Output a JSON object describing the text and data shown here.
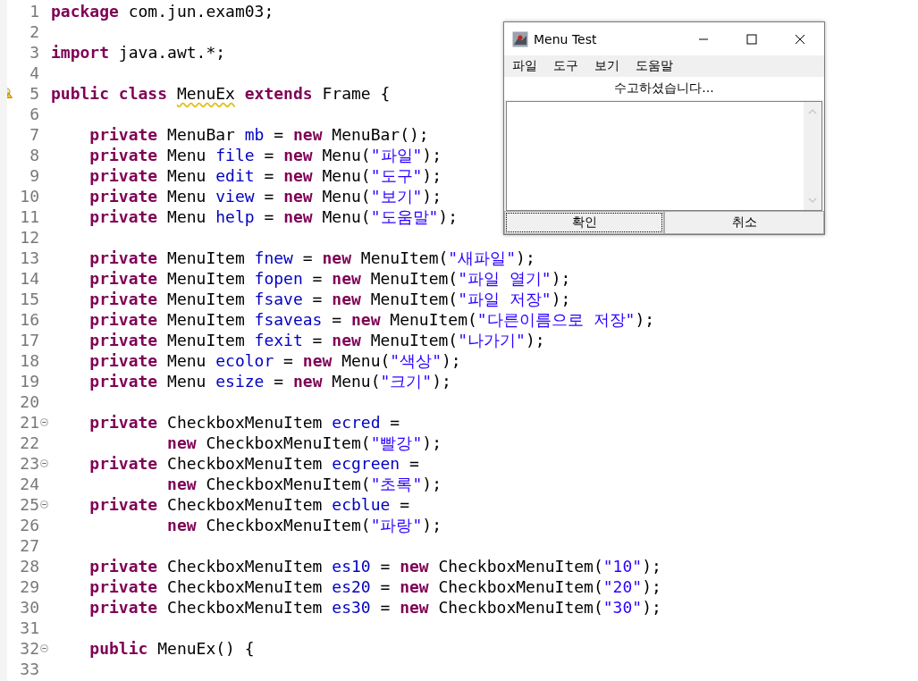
{
  "editor": {
    "lines": [
      {
        "number": "1",
        "tokens": [
          {
            "kind": "kw",
            "text": "package"
          },
          {
            "kind": "plain",
            "text": " com.jun.exam03;"
          }
        ]
      },
      {
        "number": "2"
      },
      {
        "number": "3",
        "tokens": [
          {
            "kind": "kw",
            "text": "import"
          },
          {
            "kind": "plain",
            "text": " java.awt.*;"
          }
        ]
      },
      {
        "number": "4"
      },
      {
        "number": "5",
        "warning": true,
        "tokens": [
          {
            "kind": "kw",
            "text": "public class "
          },
          {
            "kind": "warned",
            "text": "MenuEx"
          },
          {
            "kind": "kw",
            "text": " extends"
          },
          {
            "kind": "plain",
            "text": " Frame {"
          }
        ]
      },
      {
        "number": "6"
      },
      {
        "number": "7",
        "tokens": [
          {
            "kind": "kw",
            "text": "    private"
          },
          {
            "kind": "plain",
            "text": " MenuBar "
          },
          {
            "kind": "field",
            "text": "mb"
          },
          {
            "kind": "plain",
            "text": " = "
          },
          {
            "kind": "kw",
            "text": "new"
          },
          {
            "kind": "plain",
            "text": " MenuBar();"
          }
        ]
      },
      {
        "number": "8",
        "tokens": [
          {
            "kind": "kw",
            "text": "    private"
          },
          {
            "kind": "plain",
            "text": " Menu "
          },
          {
            "kind": "field",
            "text": "file"
          },
          {
            "kind": "plain",
            "text": " = "
          },
          {
            "kind": "kw",
            "text": "new"
          },
          {
            "kind": "plain",
            "text": " Menu("
          },
          {
            "kind": "str",
            "text": "\"파일\""
          },
          {
            "kind": "plain",
            "text": ");"
          }
        ]
      },
      {
        "number": "9",
        "tokens": [
          {
            "kind": "kw",
            "text": "    private"
          },
          {
            "kind": "plain",
            "text": " Menu "
          },
          {
            "kind": "field",
            "text": "edit"
          },
          {
            "kind": "plain",
            "text": " = "
          },
          {
            "kind": "kw",
            "text": "new"
          },
          {
            "kind": "plain",
            "text": " Menu("
          },
          {
            "kind": "str",
            "text": "\"도구\""
          },
          {
            "kind": "plain",
            "text": ");"
          }
        ]
      },
      {
        "number": "10",
        "tokens": [
          {
            "kind": "kw",
            "text": "    private"
          },
          {
            "kind": "plain",
            "text": " Menu "
          },
          {
            "kind": "field",
            "text": "view"
          },
          {
            "kind": "plain",
            "text": " = "
          },
          {
            "kind": "kw",
            "text": "new"
          },
          {
            "kind": "plain",
            "text": " Menu("
          },
          {
            "kind": "str",
            "text": "\"보기\""
          },
          {
            "kind": "plain",
            "text": ");"
          }
        ]
      },
      {
        "number": "11",
        "tokens": [
          {
            "kind": "kw",
            "text": "    private"
          },
          {
            "kind": "plain",
            "text": " Menu "
          },
          {
            "kind": "field",
            "text": "help"
          },
          {
            "kind": "plain",
            "text": " = "
          },
          {
            "kind": "kw",
            "text": "new"
          },
          {
            "kind": "plain",
            "text": " Menu("
          },
          {
            "kind": "str",
            "text": "\"도움말\""
          },
          {
            "kind": "plain",
            "text": ");"
          }
        ]
      },
      {
        "number": "12"
      },
      {
        "number": "13",
        "tokens": [
          {
            "kind": "kw",
            "text": "    private"
          },
          {
            "kind": "plain",
            "text": " MenuItem "
          },
          {
            "kind": "field",
            "text": "fnew"
          },
          {
            "kind": "plain",
            "text": " = "
          },
          {
            "kind": "kw",
            "text": "new"
          },
          {
            "kind": "plain",
            "text": " MenuItem("
          },
          {
            "kind": "str",
            "text": "\"새파일\""
          },
          {
            "kind": "plain",
            "text": ");"
          }
        ]
      },
      {
        "number": "14",
        "tokens": [
          {
            "kind": "kw",
            "text": "    private"
          },
          {
            "kind": "plain",
            "text": " MenuItem "
          },
          {
            "kind": "field",
            "text": "fopen"
          },
          {
            "kind": "plain",
            "text": " = "
          },
          {
            "kind": "kw",
            "text": "new"
          },
          {
            "kind": "plain",
            "text": " MenuItem("
          },
          {
            "kind": "str",
            "text": "\"파일 열기\""
          },
          {
            "kind": "plain",
            "text": ");"
          }
        ]
      },
      {
        "number": "15",
        "tokens": [
          {
            "kind": "kw",
            "text": "    private"
          },
          {
            "kind": "plain",
            "text": " MenuItem "
          },
          {
            "kind": "field",
            "text": "fsave"
          },
          {
            "kind": "plain",
            "text": " = "
          },
          {
            "kind": "kw",
            "text": "new"
          },
          {
            "kind": "plain",
            "text": " MenuItem("
          },
          {
            "kind": "str",
            "text": "\"파일 저장\""
          },
          {
            "kind": "plain",
            "text": ");"
          }
        ]
      },
      {
        "number": "16",
        "tokens": [
          {
            "kind": "kw",
            "text": "    private"
          },
          {
            "kind": "plain",
            "text": " MenuItem "
          },
          {
            "kind": "field",
            "text": "fsaveas"
          },
          {
            "kind": "plain",
            "text": " = "
          },
          {
            "kind": "kw",
            "text": "new"
          },
          {
            "kind": "plain",
            "text": " MenuItem("
          },
          {
            "kind": "str",
            "text": "\"다른이름으로 저장\""
          },
          {
            "kind": "plain",
            "text": ");"
          }
        ]
      },
      {
        "number": "17",
        "tokens": [
          {
            "kind": "kw",
            "text": "    private"
          },
          {
            "kind": "plain",
            "text": " MenuItem "
          },
          {
            "kind": "field",
            "text": "fexit"
          },
          {
            "kind": "plain",
            "text": " = "
          },
          {
            "kind": "kw",
            "text": "new"
          },
          {
            "kind": "plain",
            "text": " MenuItem("
          },
          {
            "kind": "str",
            "text": "\"나가기\""
          },
          {
            "kind": "plain",
            "text": ");"
          }
        ]
      },
      {
        "number": "18",
        "tokens": [
          {
            "kind": "kw",
            "text": "    private"
          },
          {
            "kind": "plain",
            "text": " Menu "
          },
          {
            "kind": "field",
            "text": "ecolor"
          },
          {
            "kind": "plain",
            "text": " = "
          },
          {
            "kind": "kw",
            "text": "new"
          },
          {
            "kind": "plain",
            "text": " Menu("
          },
          {
            "kind": "str",
            "text": "\"색상\""
          },
          {
            "kind": "plain",
            "text": ");"
          }
        ]
      },
      {
        "number": "19",
        "tokens": [
          {
            "kind": "kw",
            "text": "    private"
          },
          {
            "kind": "plain",
            "text": " Menu "
          },
          {
            "kind": "field",
            "text": "esize"
          },
          {
            "kind": "plain",
            "text": " = "
          },
          {
            "kind": "kw",
            "text": "new"
          },
          {
            "kind": "plain",
            "text": " Menu("
          },
          {
            "kind": "str",
            "text": "\"크기\""
          },
          {
            "kind": "plain",
            "text": ");"
          }
        ]
      },
      {
        "number": "20"
      },
      {
        "number": "21",
        "fold": true,
        "tokens": [
          {
            "kind": "kw",
            "text": "    private"
          },
          {
            "kind": "plain",
            "text": " CheckboxMenuItem "
          },
          {
            "kind": "field",
            "text": "ecred"
          },
          {
            "kind": "plain",
            "text": " ="
          }
        ]
      },
      {
        "number": "22",
        "tokens": [
          {
            "kind": "kw",
            "text": "            new"
          },
          {
            "kind": "plain",
            "text": " CheckboxMenuItem("
          },
          {
            "kind": "str",
            "text": "\"빨강\""
          },
          {
            "kind": "plain",
            "text": ");"
          }
        ]
      },
      {
        "number": "23",
        "fold": true,
        "tokens": [
          {
            "kind": "kw",
            "text": "    private"
          },
          {
            "kind": "plain",
            "text": " CheckboxMenuItem "
          },
          {
            "kind": "field",
            "text": "ecgreen"
          },
          {
            "kind": "plain",
            "text": " ="
          }
        ]
      },
      {
        "number": "24",
        "tokens": [
          {
            "kind": "kw",
            "text": "            new"
          },
          {
            "kind": "plain",
            "text": " CheckboxMenuItem("
          },
          {
            "kind": "str",
            "text": "\"초록\""
          },
          {
            "kind": "plain",
            "text": ");"
          }
        ]
      },
      {
        "number": "25",
        "fold": true,
        "tokens": [
          {
            "kind": "kw",
            "text": "    private"
          },
          {
            "kind": "plain",
            "text": " CheckboxMenuItem "
          },
          {
            "kind": "field",
            "text": "ecblue"
          },
          {
            "kind": "plain",
            "text": " ="
          }
        ]
      },
      {
        "number": "26",
        "tokens": [
          {
            "kind": "kw",
            "text": "            new"
          },
          {
            "kind": "plain",
            "text": " CheckboxMenuItem("
          },
          {
            "kind": "str",
            "text": "\"파랑\""
          },
          {
            "kind": "plain",
            "text": ");"
          }
        ]
      },
      {
        "number": "27"
      },
      {
        "number": "28",
        "tokens": [
          {
            "kind": "kw",
            "text": "    private"
          },
          {
            "kind": "plain",
            "text": " CheckboxMenuItem "
          },
          {
            "kind": "field",
            "text": "es10"
          },
          {
            "kind": "plain",
            "text": " = "
          },
          {
            "kind": "kw",
            "text": "new"
          },
          {
            "kind": "plain",
            "text": " CheckboxMenuItem("
          },
          {
            "kind": "str",
            "text": "\"10\""
          },
          {
            "kind": "plain",
            "text": ");"
          }
        ]
      },
      {
        "number": "29",
        "tokens": [
          {
            "kind": "kw",
            "text": "    private"
          },
          {
            "kind": "plain",
            "text": " CheckboxMenuItem "
          },
          {
            "kind": "field",
            "text": "es20"
          },
          {
            "kind": "plain",
            "text": " = "
          },
          {
            "kind": "kw",
            "text": "new"
          },
          {
            "kind": "plain",
            "text": " CheckboxMenuItem("
          },
          {
            "kind": "str",
            "text": "\"20\""
          },
          {
            "kind": "plain",
            "text": ");"
          }
        ]
      },
      {
        "number": "30",
        "tokens": [
          {
            "kind": "kw",
            "text": "    private"
          },
          {
            "kind": "plain",
            "text": " CheckboxMenuItem "
          },
          {
            "kind": "field",
            "text": "es30"
          },
          {
            "kind": "plain",
            "text": " = "
          },
          {
            "kind": "kw",
            "text": "new"
          },
          {
            "kind": "plain",
            "text": " CheckboxMenuItem("
          },
          {
            "kind": "str",
            "text": "\"30\""
          },
          {
            "kind": "plain",
            "text": ");"
          }
        ]
      },
      {
        "number": "31"
      },
      {
        "number": "32",
        "fold": true,
        "tokens": [
          {
            "kind": "kw",
            "text": "    public"
          },
          {
            "kind": "plain",
            "text": " MenuEx() {"
          }
        ]
      },
      {
        "number": "33"
      }
    ]
  },
  "window": {
    "title": "Menu Test",
    "menus": [
      "파일",
      "도구",
      "보기",
      "도움말"
    ],
    "label": "수고하셨습니다...",
    "buttons": [
      {
        "label": "확인",
        "focused": true
      },
      {
        "label": "취소",
        "focused": false
      }
    ]
  }
}
